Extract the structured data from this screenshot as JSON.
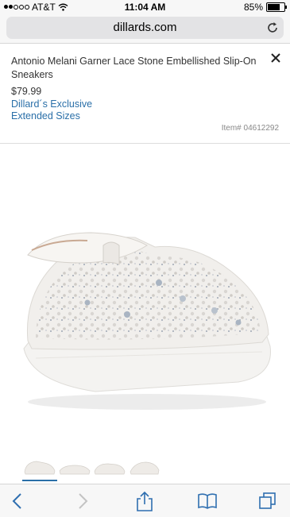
{
  "status_bar": {
    "carrier": "AT&T",
    "time": "11:04 AM",
    "battery": "85%",
    "battery_level": 0.85
  },
  "browser": {
    "url": "dillards.com"
  },
  "product": {
    "title": "Antonio Melani Garner Lace Stone Embellished Slip-On Sneakers",
    "price": "$79.99",
    "exclusive_label": "Dillard´s Exclusive",
    "sizes_label": "Extended Sizes",
    "item_number": "Item# 04612292"
  },
  "toolbar": {
    "icons": [
      "back-icon",
      "forward-icon",
      "share-icon",
      "bookmarks-icon",
      "tabs-icon"
    ]
  }
}
